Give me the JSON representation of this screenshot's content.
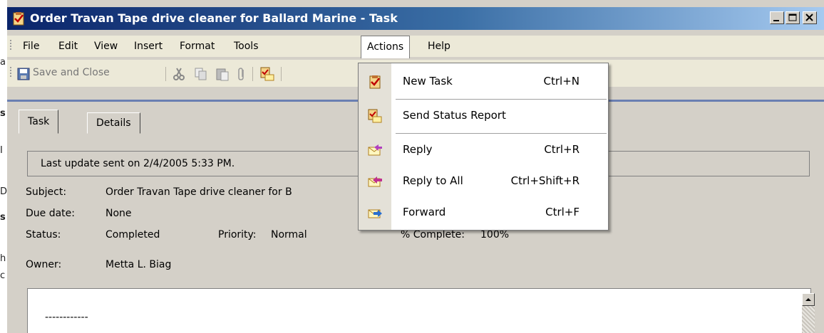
{
  "window": {
    "title": "Order Travan Tape drive cleaner for Ballard Marine - Task",
    "title_icon": "task-clipboard-icon",
    "controls": {
      "minimize": "_",
      "maximize": "□",
      "close": "×"
    }
  },
  "menubar": {
    "items": [
      "File",
      "Edit",
      "View",
      "Insert",
      "Format",
      "Tools",
      "Actions",
      "Help"
    ],
    "open_menu": "Actions"
  },
  "toolbar": {
    "save_label": "Save and Close",
    "icons": [
      "save-icon",
      "cut-icon",
      "copy-icon",
      "paste-icon",
      "attach-icon",
      "send-status-report-icon"
    ]
  },
  "tabs": [
    {
      "label": "Task",
      "selected": true
    },
    {
      "label": "Details",
      "selected": false
    }
  ],
  "infobar": "Last update sent on 2/4/2005 5:33 PM.",
  "fields": {
    "subject_label": "Subject:",
    "subject_value": "Order Travan Tape drive cleaner for B",
    "due_label": "Due date:",
    "due_value": "None",
    "status_label": "Status:",
    "status_value": "Completed",
    "priority_label": "Priority:",
    "priority_value": "Normal",
    "complete_label": "% Complete:",
    "complete_value": "100%",
    "owner_label": "Owner:",
    "owner_value": "Metta L. Biag"
  },
  "body": {
    "text": "------------"
  },
  "actions_menu": [
    {
      "label": "New Task",
      "shortcut": "Ctrl+N",
      "icon": "new-task-icon"
    },
    {
      "label": "Send Status Report",
      "shortcut": "",
      "icon": "send-status-report-icon"
    },
    {
      "label": "Reply",
      "shortcut": "Ctrl+R",
      "icon": "reply-icon"
    },
    {
      "label": "Reply to All",
      "shortcut": "Ctrl+Shift+R",
      "icon": "reply-all-icon"
    },
    {
      "label": "Forward",
      "shortcut": "Ctrl+F",
      "icon": "forward-icon"
    }
  ],
  "background_glyphs": [
    "a",
    "s",
    "I",
    "D",
    "s",
    "h",
    "c"
  ],
  "colors": {
    "title_start": "#0a246a",
    "title_end": "#a6caf0",
    "menu_bg": "#ece9d8",
    "window_bg": "#d4d0c8",
    "accent_line": "#6a7fb2"
  }
}
